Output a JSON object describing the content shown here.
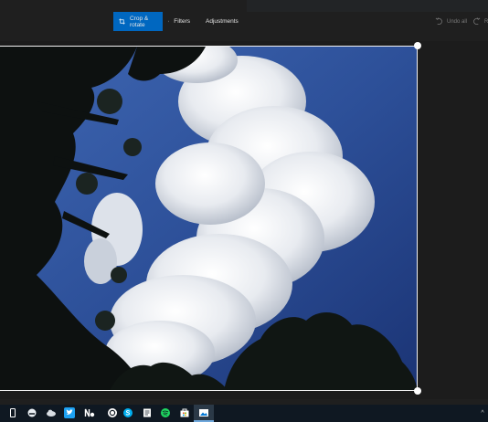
{
  "toolbar": {
    "crop_rotate_label": "Crop & rotate",
    "filters_label": "Filters",
    "adjustments_label": "Adjustments",
    "undo_all_label": "Undo all",
    "redo_label": "R"
  },
  "colors": {
    "accent": "#0067c0",
    "background": "#1f1f1f",
    "taskbar": "#0f1822",
    "sky": "#2c4f98"
  },
  "taskbar": {
    "icons": [
      "phone-icon",
      "edge-legacy-icon",
      "onedrive-icon",
      "twitter-icon",
      "news-icon",
      "skype-icon",
      "notes-icon",
      "spotify-icon",
      "store-icon",
      "photos-icon"
    ],
    "chevron": "^"
  }
}
